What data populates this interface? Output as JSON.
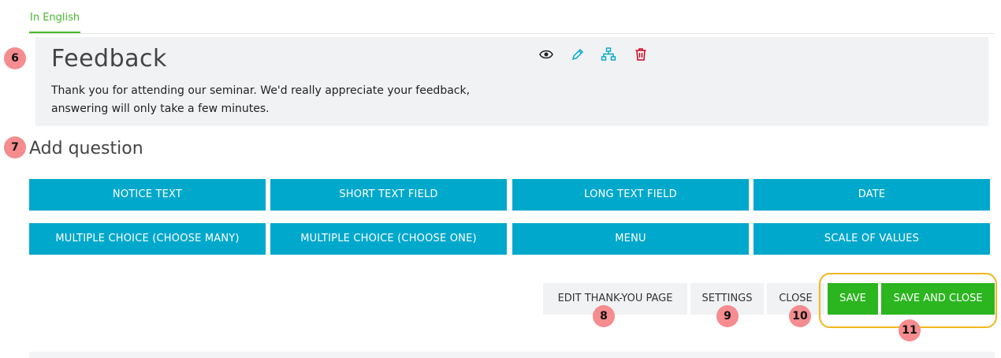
{
  "tabs": [
    {
      "label": "In English",
      "active": true
    }
  ],
  "feedback": {
    "title": "Feedback",
    "description": "Thank you for attending our seminar. We'd really appreciate your feedback, answering will only take a few minutes.",
    "icons": [
      "eye-icon",
      "pencil-icon",
      "sitemap-icon",
      "trash-icon"
    ]
  },
  "add_question": {
    "heading": "Add question",
    "buttons": [
      "NOTICE TEXT",
      "SHORT TEXT FIELD",
      "LONG TEXT FIELD",
      "DATE",
      "MULTIPLE CHOICE (CHOOSE MANY)",
      "MULTIPLE CHOICE (CHOOSE ONE)",
      "MENU",
      "SCALE OF VALUES"
    ]
  },
  "actions": {
    "edit_thank_you": "EDIT THANK-YOU PAGE",
    "settings": "SETTINGS",
    "close": "CLOSE",
    "save": "SAVE",
    "save_and_close": "SAVE AND CLOSE"
  },
  "annotations": [
    "6",
    "7",
    "8",
    "9",
    "10",
    "11"
  ],
  "colors": {
    "accent_green": "#44b82c",
    "question_button": "#00a8cc",
    "save_green": "#2bb51f",
    "highlight": "#f2b71d",
    "badge": "#f58c8f",
    "delete_red": "#d0021b"
  }
}
